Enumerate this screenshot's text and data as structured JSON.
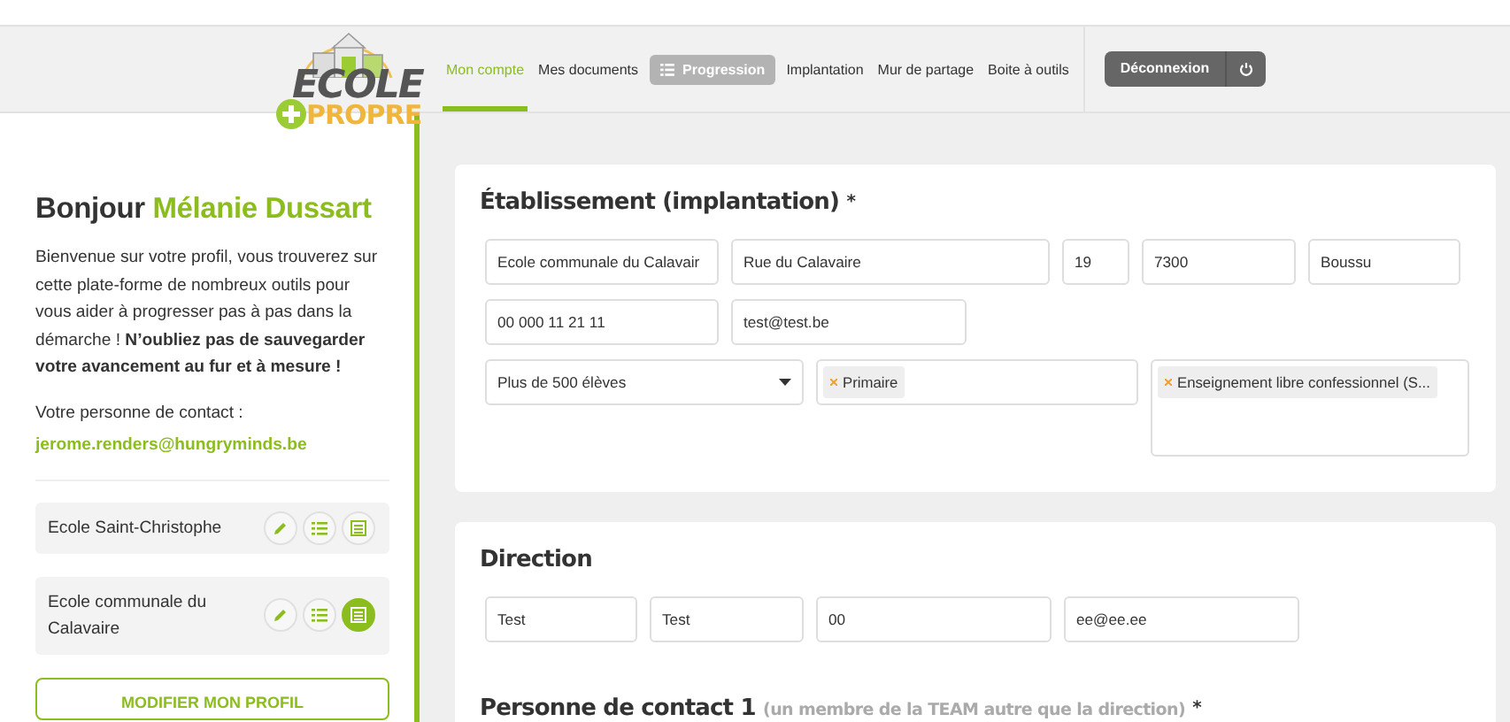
{
  "header": {
    "logo": {
      "line1": "ECOLE",
      "line2": "PROPRE"
    },
    "nav": [
      {
        "kind": "link",
        "label": "Mon compte",
        "selected": true
      },
      {
        "kind": "link",
        "label": "Mes documents",
        "selected": false
      },
      {
        "kind": "button",
        "label": "Progression",
        "selected": false
      },
      {
        "kind": "link",
        "label": "Implantation",
        "selected": false
      },
      {
        "kind": "link",
        "label": "Mur de partage",
        "selected": false
      },
      {
        "kind": "link",
        "label": "Boite à outils",
        "selected": false
      }
    ],
    "logout": {
      "label": "Déconnexion"
    }
  },
  "sidebar": {
    "greeting": "Bonjour",
    "name": "Mélanie Dussart",
    "intro": "Bienvenue sur votre profil, vous trouverez sur cette plate-forme de nombreux outils pour vous aider à progresser pas à pas dans la démarche ! **N’oubliez pas de sauvegarder votre avancement au fur et à mesure !**",
    "contact_label": "Votre personne de contact :",
    "contact_email": "jerome.renders@hungryminds.be",
    "schools": [
      {
        "name": "Ecole Saint-Christophe",
        "selected": false
      },
      {
        "name": "Ecole communale du Calavaire",
        "selected": true
      }
    ],
    "profile_button": "MODIFIER MON PROFIL"
  },
  "cards": [
    {
      "blocks": [
        {
          "title": "Établissement (implantation)",
          "required_mark": "*",
          "field_groups": [
            {
              "fields": [
                {
                  "kind": "text",
                  "value": "Ecole communale du Calavair"
                },
                {
                  "kind": "text",
                  "value": "Rue du Calavaire"
                },
                {
                  "kind": "text",
                  "value": "19"
                },
                {
                  "kind": "text",
                  "value": "7300"
                },
                {
                  "kind": "text",
                  "value": "Boussu"
                }
              ]
            },
            {
              "fields": [
                {
                  "kind": "text",
                  "value": "00 000 11 21 11"
                },
                {
                  "kind": "text",
                  "value": "test@test.be"
                }
              ]
            },
            {
              "fields": [
                {
                  "kind": "select",
                  "value": "Plus de 500 élèves"
                },
                {
                  "kind": "tags",
                  "tags": [
                    "Primaire"
                  ]
                },
                {
                  "kind": "tag-area",
                  "tags": [
                    "Enseignement libre confessionnel (S..."
                  ]
                }
              ]
            }
          ]
        }
      ]
    },
    {
      "blocks": [
        {
          "title": "Direction",
          "field_groups": [
            {
              "fields": [
                {
                  "kind": "text",
                  "value": "Test"
                },
                {
                  "kind": "text",
                  "value": "Test"
                },
                {
                  "kind": "text",
                  "value": "00"
                },
                {
                  "kind": "text",
                  "value": "ee@ee.ee"
                }
              ]
            }
          ]
        },
        {
          "title": "Personne de contact 1",
          "note": "(un membre de la TEAM autre que la direction)",
          "required_mark": "*"
        }
      ]
    }
  ]
}
